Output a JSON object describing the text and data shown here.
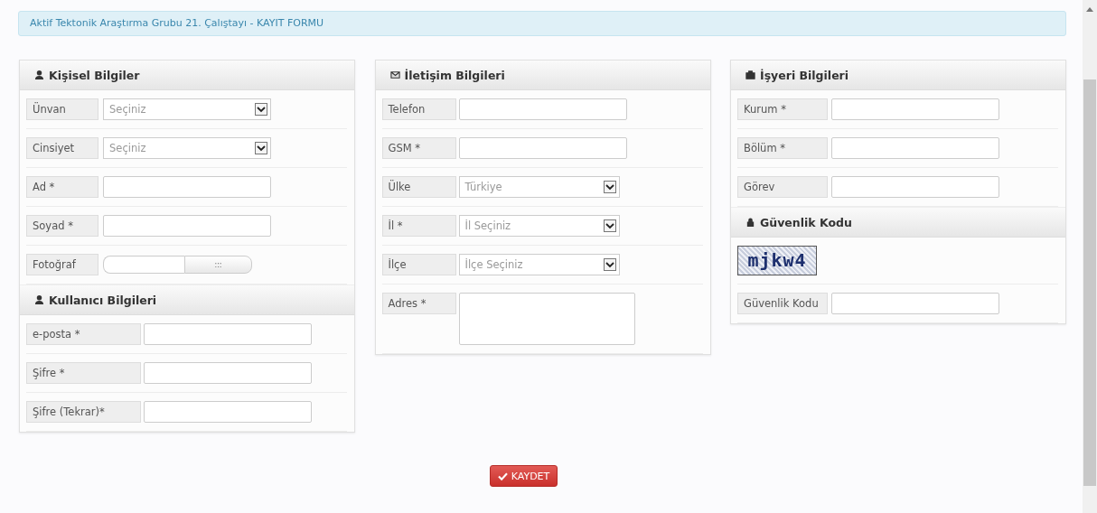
{
  "banner": "Aktif Tektonik Araştırma Grubu 21. Çalıştayı - KAYIT FORMU",
  "columns": [
    {
      "sections": [
        {
          "title": "Kişisel Bilgiler",
          "kind": "user",
          "fields": [
            {
              "kind": "select",
              "label": "Ünvan",
              "value": "Seçiniz"
            },
            {
              "kind": "select",
              "label": "Cinsiyet",
              "value": "Seçiniz"
            },
            {
              "kind": "text",
              "label": "Ad *"
            },
            {
              "kind": "text",
              "label": "Soyad *"
            },
            {
              "kind": "file",
              "label": "Fotoğraf",
              "button": ":::"
            }
          ]
        },
        {
          "title": "Kullanıcı Bilgileri",
          "kind": "user",
          "fields": [
            {
              "kind": "text",
              "label": "e-posta *"
            },
            {
              "kind": "text",
              "label": "Şifre *"
            },
            {
              "kind": "text",
              "label": "Şifre (Tekrar)*"
            }
          ]
        }
      ]
    },
    {
      "sections": [
        {
          "title": "İletişim Bilgileri",
          "kind": "contact",
          "fields": [
            {
              "kind": "text",
              "label": "Telefon"
            },
            {
              "kind": "text",
              "label": "GSM *"
            },
            {
              "kind": "select",
              "label": "Ülke",
              "value": "Türkiye"
            },
            {
              "kind": "select",
              "label": "İl *",
              "value": "İl Seçiniz"
            },
            {
              "kind": "select",
              "label": "İlçe",
              "value": "İlçe Seçiniz"
            },
            {
              "kind": "textarea",
              "label": "Adres *"
            }
          ]
        }
      ]
    },
    {
      "sections": [
        {
          "title": "İşyeri Bilgileri",
          "kind": "work",
          "fields": [
            {
              "kind": "text",
              "label": "Kurum *"
            },
            {
              "kind": "text",
              "label": "Bölüm *"
            },
            {
              "kind": "text",
              "label": "Görev"
            }
          ]
        },
        {
          "title": "Güvenlik Kodu",
          "kind": "security",
          "fields": [
            {
              "kind": "captcha",
              "code": "mjkw4"
            },
            {
              "kind": "text",
              "label": "Güvenlik Kodu"
            }
          ]
        }
      ]
    }
  ],
  "submit": "KAYDET"
}
